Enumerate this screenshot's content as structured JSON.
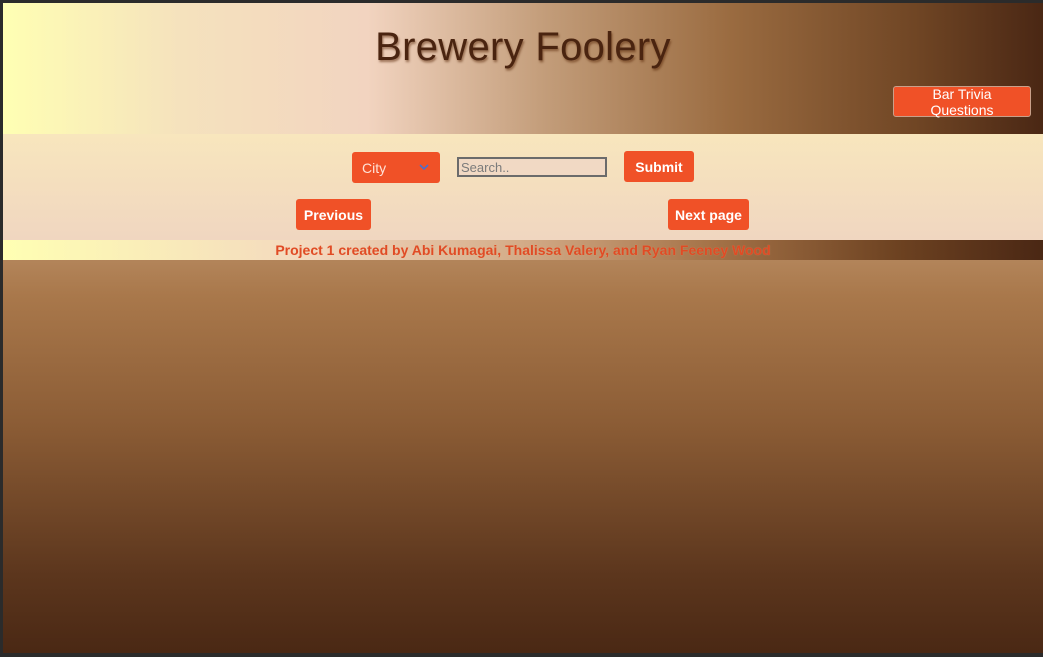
{
  "header": {
    "title": "Brewery Foolery",
    "trivia_button": "Bar Trivia Questions"
  },
  "search": {
    "city_select": "City",
    "input_placeholder": "Search..",
    "submit_label": "Submit"
  },
  "pagination": {
    "previous_label": "Previous",
    "next_label": "Next page"
  },
  "footer": {
    "credit": "Project 1 created by Abi Kumagai, Thalissa Valery, and Ryan Feeney Wood"
  },
  "colors": {
    "accent": "#f05127",
    "title": "#4a2410"
  },
  "icons": {
    "city_dropdown": "chevron-down-icon"
  }
}
